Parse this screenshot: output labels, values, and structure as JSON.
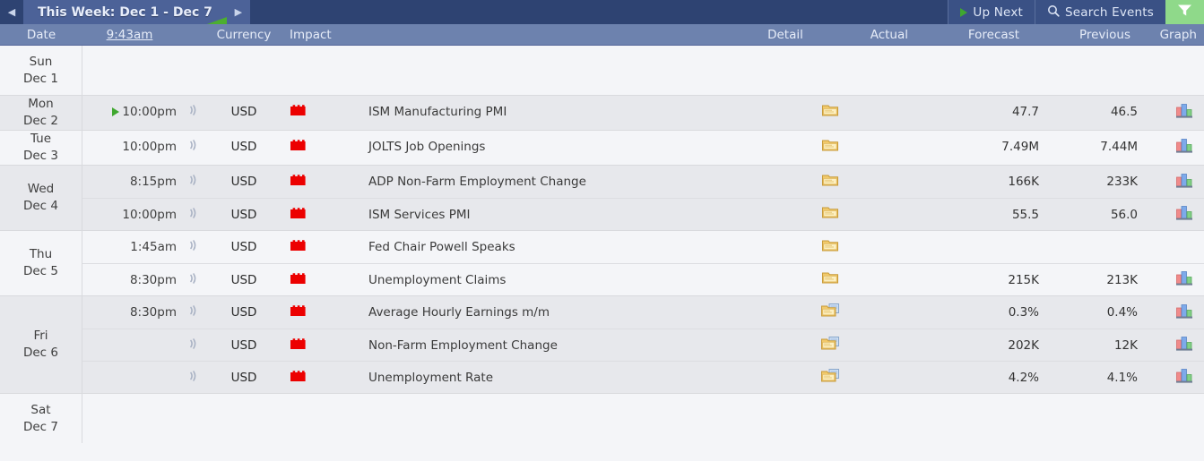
{
  "topbar": {
    "prev_label": "◀",
    "next_label": "▶",
    "week_tab_label": "This Week: Dec 1 - Dec 7",
    "up_next_label": "Up Next",
    "search_label": "Search Events",
    "filter_label": "",
    "accent_green": "#4caf2f",
    "filter_bg": "#8fd98a",
    "bar_bg": "#2e4372",
    "tab_bg": "#4c6298"
  },
  "columns": {
    "date": "Date",
    "time": "9:43am",
    "currency": "Currency",
    "impact": "Impact",
    "detail": "Detail",
    "actual": "Actual",
    "forecast": "Forecast",
    "previous": "Previous",
    "graph": "Graph",
    "header_bg": "#6d82ae"
  },
  "days": [
    {
      "dow": "Sun",
      "date": "Dec 1",
      "shade": "light",
      "events": []
    },
    {
      "dow": "Mon",
      "date": "Dec 2",
      "shade": "dark",
      "events": [
        {
          "time": "10:00pm",
          "has_play": true,
          "sound_icon": "sound-icon",
          "currency": "USD",
          "impact": "high",
          "impact_color": "#ec0000",
          "title": "ISM Manufacturing PMI",
          "detail_icon": "folder-icon",
          "actual": "",
          "forecast": "47.7",
          "previous": "46.5",
          "graph_icon": "bar-chart-icon"
        }
      ]
    },
    {
      "dow": "Tue",
      "date": "Dec 3",
      "shade": "light",
      "events": [
        {
          "time": "10:00pm",
          "has_play": false,
          "sound_icon": "sound-icon",
          "currency": "USD",
          "impact": "high",
          "impact_color": "#ec0000",
          "title": "JOLTS Job Openings",
          "detail_icon": "folder-icon",
          "actual": "",
          "forecast": "7.49M",
          "previous": "7.44M",
          "graph_icon": "bar-chart-icon"
        }
      ]
    },
    {
      "dow": "Wed",
      "date": "Dec 4",
      "shade": "dark",
      "events": [
        {
          "time": "8:15pm",
          "has_play": false,
          "sound_icon": "sound-icon",
          "currency": "USD",
          "impact": "high",
          "impact_color": "#ec0000",
          "title": "ADP Non-Farm Employment Change",
          "detail_icon": "folder-icon",
          "actual": "",
          "forecast": "166K",
          "previous": "233K",
          "graph_icon": "bar-chart-icon"
        },
        {
          "time": "10:00pm",
          "has_play": false,
          "sound_icon": "sound-icon",
          "currency": "USD",
          "impact": "high",
          "impact_color": "#ec0000",
          "title": "ISM Services PMI",
          "detail_icon": "folder-icon",
          "actual": "",
          "forecast": "55.5",
          "previous": "56.0",
          "graph_icon": "bar-chart-icon"
        }
      ]
    },
    {
      "dow": "Thu",
      "date": "Dec 5",
      "shade": "light",
      "events": [
        {
          "time": "1:45am",
          "has_play": false,
          "sound_icon": "sound-icon",
          "currency": "USD",
          "impact": "high",
          "impact_color": "#ec0000",
          "title": "Fed Chair Powell Speaks",
          "detail_icon": "folder-icon",
          "actual": "",
          "forecast": "",
          "previous": "",
          "graph_icon": ""
        },
        {
          "time": "8:30pm",
          "has_play": false,
          "sound_icon": "sound-icon",
          "currency": "USD",
          "impact": "high",
          "impact_color": "#ec0000",
          "title": "Unemployment Claims",
          "detail_icon": "folder-icon",
          "actual": "",
          "forecast": "215K",
          "previous": "213K",
          "graph_icon": "bar-chart-icon"
        }
      ]
    },
    {
      "dow": "Fri",
      "date": "Dec 6",
      "shade": "dark",
      "events": [
        {
          "time": "8:30pm",
          "has_play": false,
          "sound_icon": "sound-icon",
          "currency": "USD",
          "impact": "high",
          "impact_color": "#ec0000",
          "title": "Average Hourly Earnings m/m",
          "detail_icon": "folder-note-icon",
          "actual": "",
          "forecast": "0.3%",
          "previous": "0.4%",
          "graph_icon": "bar-chart-icon"
        },
        {
          "time": "",
          "has_play": false,
          "sound_icon": "sound-icon",
          "currency": "USD",
          "impact": "high",
          "impact_color": "#ec0000",
          "title": "Non-Farm Employment Change",
          "detail_icon": "folder-note-icon",
          "actual": "",
          "forecast": "202K",
          "previous": "12K",
          "graph_icon": "bar-chart-icon"
        },
        {
          "time": "",
          "has_play": false,
          "sound_icon": "sound-icon",
          "currency": "USD",
          "impact": "high",
          "impact_color": "#ec0000",
          "title": "Unemployment Rate",
          "detail_icon": "folder-note-icon",
          "actual": "",
          "forecast": "4.2%",
          "previous": "4.1%",
          "graph_icon": "bar-chart-icon"
        }
      ]
    },
    {
      "dow": "Sat",
      "date": "Dec 7",
      "shade": "light",
      "events": []
    }
  ]
}
